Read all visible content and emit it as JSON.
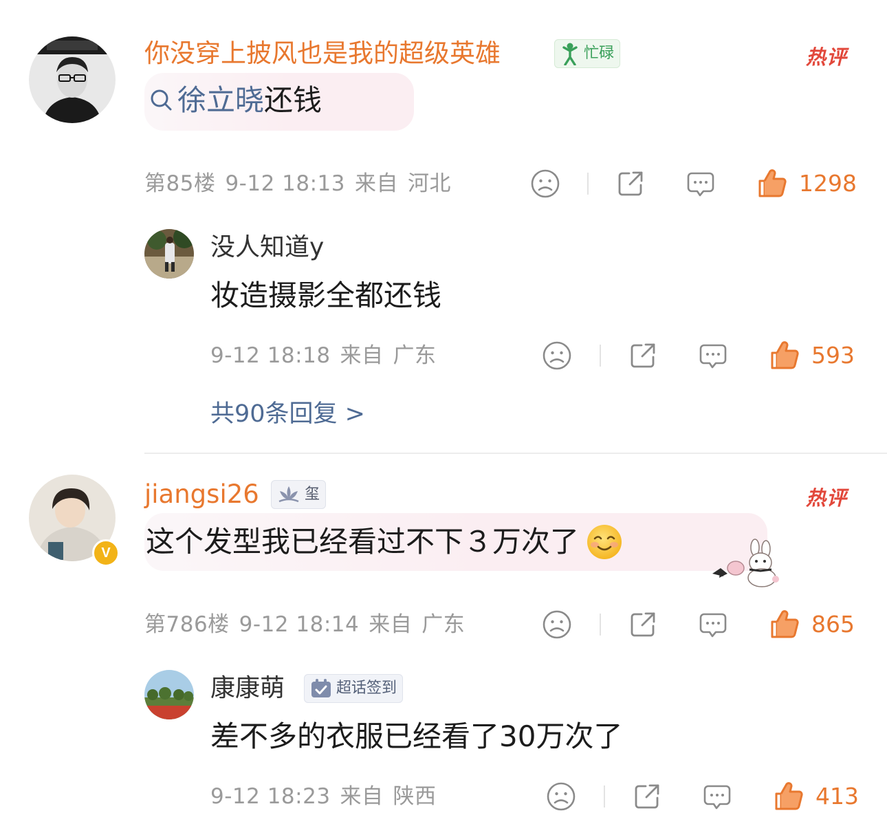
{
  "comments": [
    {
      "username": "你没穿上披风也是我的超级英雄",
      "badge_text": "忙碌",
      "hot_label": "热评",
      "search_link": "徐立晓",
      "text_after_link": "还钱",
      "floor": "第85楼",
      "time": "9-12 18:13",
      "location_prefix": "来自",
      "location": "河北",
      "likes": "1298",
      "reply": {
        "username": "没人知道y",
        "text": "妆造摄影全都还钱",
        "time": "9-12 18:18",
        "location_prefix": "来自",
        "location": "广东",
        "likes": "593"
      },
      "more_replies": "共90条回复 >"
    },
    {
      "username": "jiangsi26",
      "badge_text": "玺",
      "hot_label": "热评",
      "text": "这个发型我已经看过不下３万次了",
      "verified_badge": "V",
      "floor": "第786楼",
      "time": "9-12 18:14",
      "location_prefix": "来自",
      "location": "广东",
      "likes": "865",
      "reply": {
        "username": "康康萌",
        "badge_text": "超话签到",
        "text": "差不多的衣服已经看了30万次了",
        "time": "9-12 18:23",
        "location_prefix": "来自",
        "location": "陕西",
        "likes": "413"
      }
    }
  ],
  "colors": {
    "username_orange": "#e8782f",
    "link_blue": "#4f6b94",
    "like_orange": "#e8782f",
    "hot_red": "#e2483b",
    "meta_gray": "#9a9a9a"
  },
  "icons": [
    "search-icon",
    "dislike-face-icon",
    "share-icon",
    "comment-icon",
    "thumbs-up-icon",
    "smile-emoji-icon",
    "bunny-sticker-icon"
  ]
}
